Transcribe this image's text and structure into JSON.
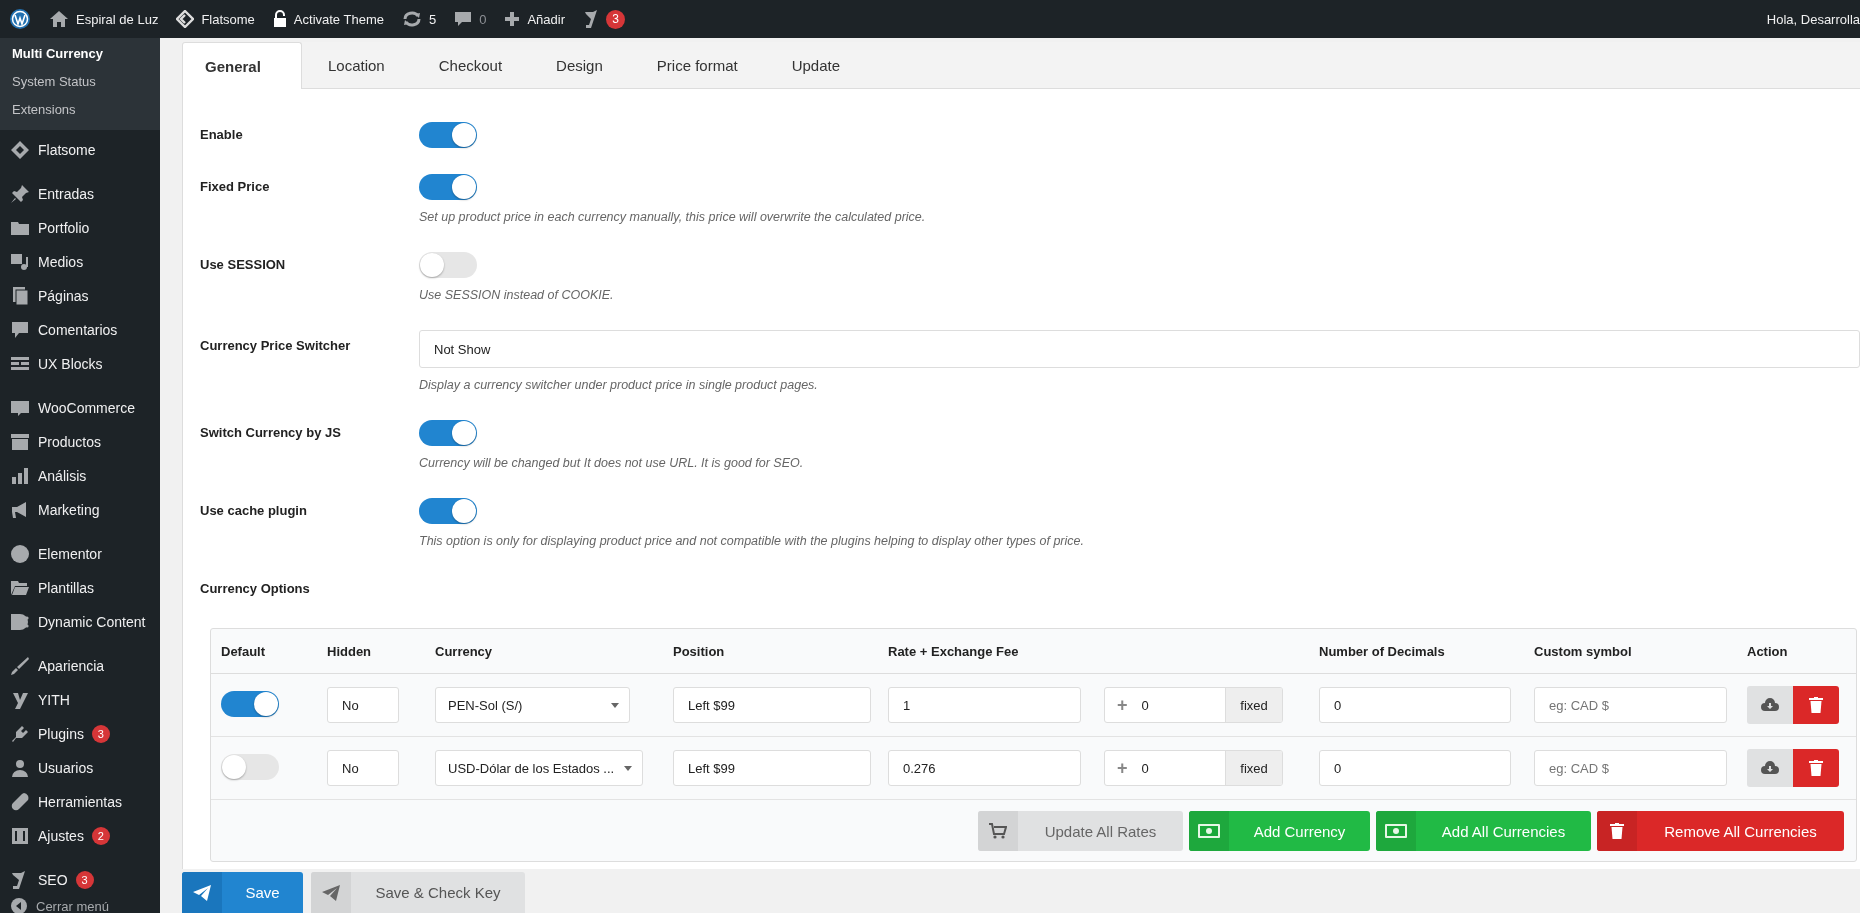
{
  "admin_bar": {
    "items": [
      {
        "label": "Espiral de Luz"
      },
      {
        "label": "Flatsome"
      },
      {
        "label": "Activate Theme"
      },
      {
        "label": "5"
      },
      {
        "label": "0"
      },
      {
        "label": "Añadir"
      }
    ],
    "seo_badge": "3",
    "greeting": "Hola, Desarrolla"
  },
  "sidebar": {
    "submenu": [
      {
        "label": "Multi Currency",
        "selected": true
      },
      {
        "label": "System Status",
        "selected": false
      },
      {
        "label": "Extensions",
        "selected": false
      }
    ],
    "groups": [
      [
        {
          "label": "Flatsome"
        }
      ],
      [
        {
          "label": "Entradas"
        },
        {
          "label": "Portfolio"
        },
        {
          "label": "Medios"
        },
        {
          "label": "Páginas"
        },
        {
          "label": "Comentarios"
        },
        {
          "label": "UX Blocks"
        }
      ],
      [
        {
          "label": "WooCommerce"
        },
        {
          "label": "Productos"
        },
        {
          "label": "Análisis"
        },
        {
          "label": "Marketing"
        }
      ],
      [
        {
          "label": "Elementor"
        },
        {
          "label": "Plantillas"
        },
        {
          "label": "Dynamic Content"
        }
      ],
      [
        {
          "label": "Apariencia"
        },
        {
          "label": "YITH"
        },
        {
          "label": "Plugins",
          "badge": "3"
        },
        {
          "label": "Usuarios"
        },
        {
          "label": "Herramientas"
        },
        {
          "label": "Ajustes",
          "badge": "2"
        }
      ],
      [
        {
          "label": "SEO",
          "badge": "3"
        }
      ]
    ],
    "collapse": "Cerrar menú"
  },
  "tabs": [
    {
      "label": "General",
      "selected": true
    },
    {
      "label": "Location",
      "selected": false
    },
    {
      "label": "Checkout",
      "selected": false
    },
    {
      "label": "Design",
      "selected": false
    },
    {
      "label": "Price format",
      "selected": false
    },
    {
      "label": "Update",
      "selected": false
    }
  ],
  "settings": [
    {
      "kind": "toggle",
      "label": "Enable",
      "on": true
    },
    {
      "kind": "toggle",
      "label": "Fixed Price",
      "on": true,
      "description": "Set up product price in each currency manually, this price will overwrite the calculated price."
    },
    {
      "kind": "toggle",
      "label": "Use SESSION",
      "on": false,
      "description": "Use SESSION instead of COOKIE."
    },
    {
      "kind": "select",
      "label": "Currency Price Switcher",
      "value": "Not Show",
      "description": "Display a currency switcher under product price in single product pages."
    },
    {
      "kind": "toggle",
      "label": "Switch Currency by JS",
      "on": true,
      "description": "Currency will be changed but It does not use URL. It is good for SEO."
    },
    {
      "kind": "toggle",
      "label": "Use cache plugin",
      "on": true,
      "description": "This option is only for displaying product price and not compatible with the plugins helping to display other types of price."
    },
    {
      "kind": "heading",
      "label": "Currency Options"
    }
  ],
  "currency_table": {
    "columns": [
      "Default",
      "Hidden",
      "Currency",
      "Position",
      "Rate + Exchange Fee",
      "Number of Decimals",
      "Custom symbol",
      "Action"
    ],
    "rows": [
      {
        "default": true,
        "hidden": "No",
        "currency": "PEN-Sol (S/)",
        "position": "Left $99",
        "rate": "1",
        "fee_sign": "+",
        "fee": "0",
        "fee_type": "fixed",
        "decimals": "0",
        "symbol_placeholder": "eg: CAD $"
      },
      {
        "default": false,
        "hidden": "No",
        "currency": "USD-Dólar de los Estados ...",
        "position": "Left $99",
        "rate": "0.276",
        "fee_sign": "+",
        "fee": "0",
        "fee_type": "fixed",
        "decimals": "0",
        "symbol_placeholder": "eg: CAD $"
      }
    ],
    "buttons": [
      {
        "kind": "update",
        "label": "Update All Rates"
      },
      {
        "kind": "add",
        "label": "Add Currency"
      },
      {
        "kind": "add_all",
        "label": "Add All Currencies"
      },
      {
        "kind": "remove",
        "label": "Remove All Currencies"
      }
    ]
  },
  "save_buttons": [
    {
      "kind": "primary",
      "label": "Save"
    },
    {
      "kind": "secondary",
      "label": "Save & Check Key"
    }
  ]
}
